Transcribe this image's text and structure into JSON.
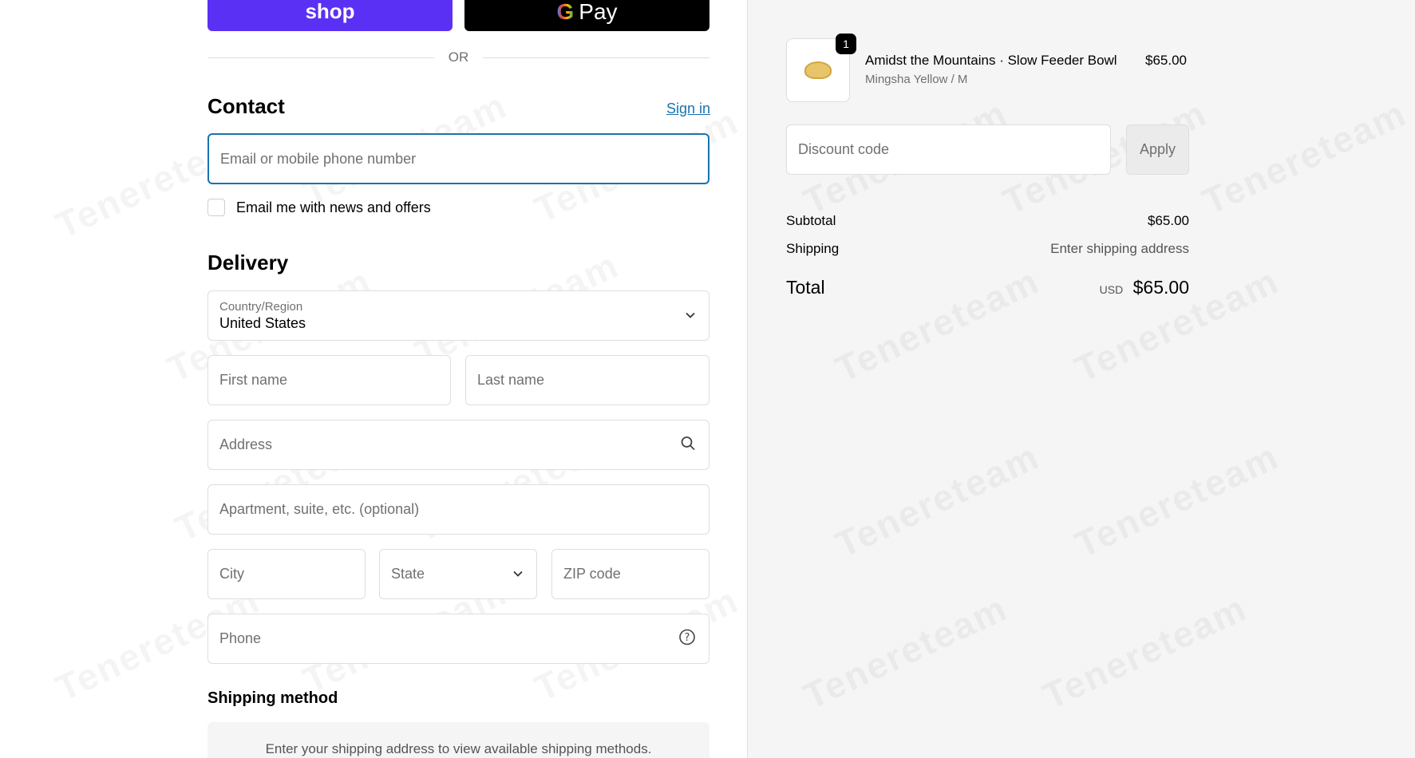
{
  "express": {
    "shop_label": "shop",
    "gpay_g": "G",
    "gpay_label": "Pay",
    "or_label": "OR"
  },
  "contact": {
    "title": "Contact",
    "sign_in": "Sign in",
    "email_placeholder": "Email or mobile phone number",
    "newsletter_label": "Email me with news and offers",
    "newsletter_checked": false
  },
  "delivery": {
    "title": "Delivery",
    "country_label": "Country/Region",
    "country_value": "United States",
    "first_name_placeholder": "First name",
    "last_name_placeholder": "Last name",
    "address_placeholder": "Address",
    "apartment_placeholder": "Apartment, suite, etc. (optional)",
    "city_placeholder": "City",
    "state_placeholder": "State",
    "zip_placeholder": "ZIP code",
    "phone_placeholder": "Phone"
  },
  "shipping_method": {
    "title": "Shipping method",
    "message": "Enter your shipping address to view available shipping methods."
  },
  "order": {
    "product": {
      "quantity": "1",
      "name": "Amidst the Mountains · Slow Feeder Bowl",
      "variant": "Mingsha Yellow / M",
      "price": "$65.00"
    },
    "discount_placeholder": "Discount code",
    "apply_label": "Apply",
    "subtotal_label": "Subtotal",
    "subtotal_value": "$65.00",
    "shipping_label": "Shipping",
    "shipping_value": "Enter shipping address",
    "total_label": "Total",
    "currency": "USD",
    "total_value": "$65.00"
  },
  "watermark": "Tenereteam",
  "colors": {
    "shop_purple": "#5a31f4",
    "focus_blue": "#1773b0",
    "summary_bg": "#f5f5f5"
  }
}
